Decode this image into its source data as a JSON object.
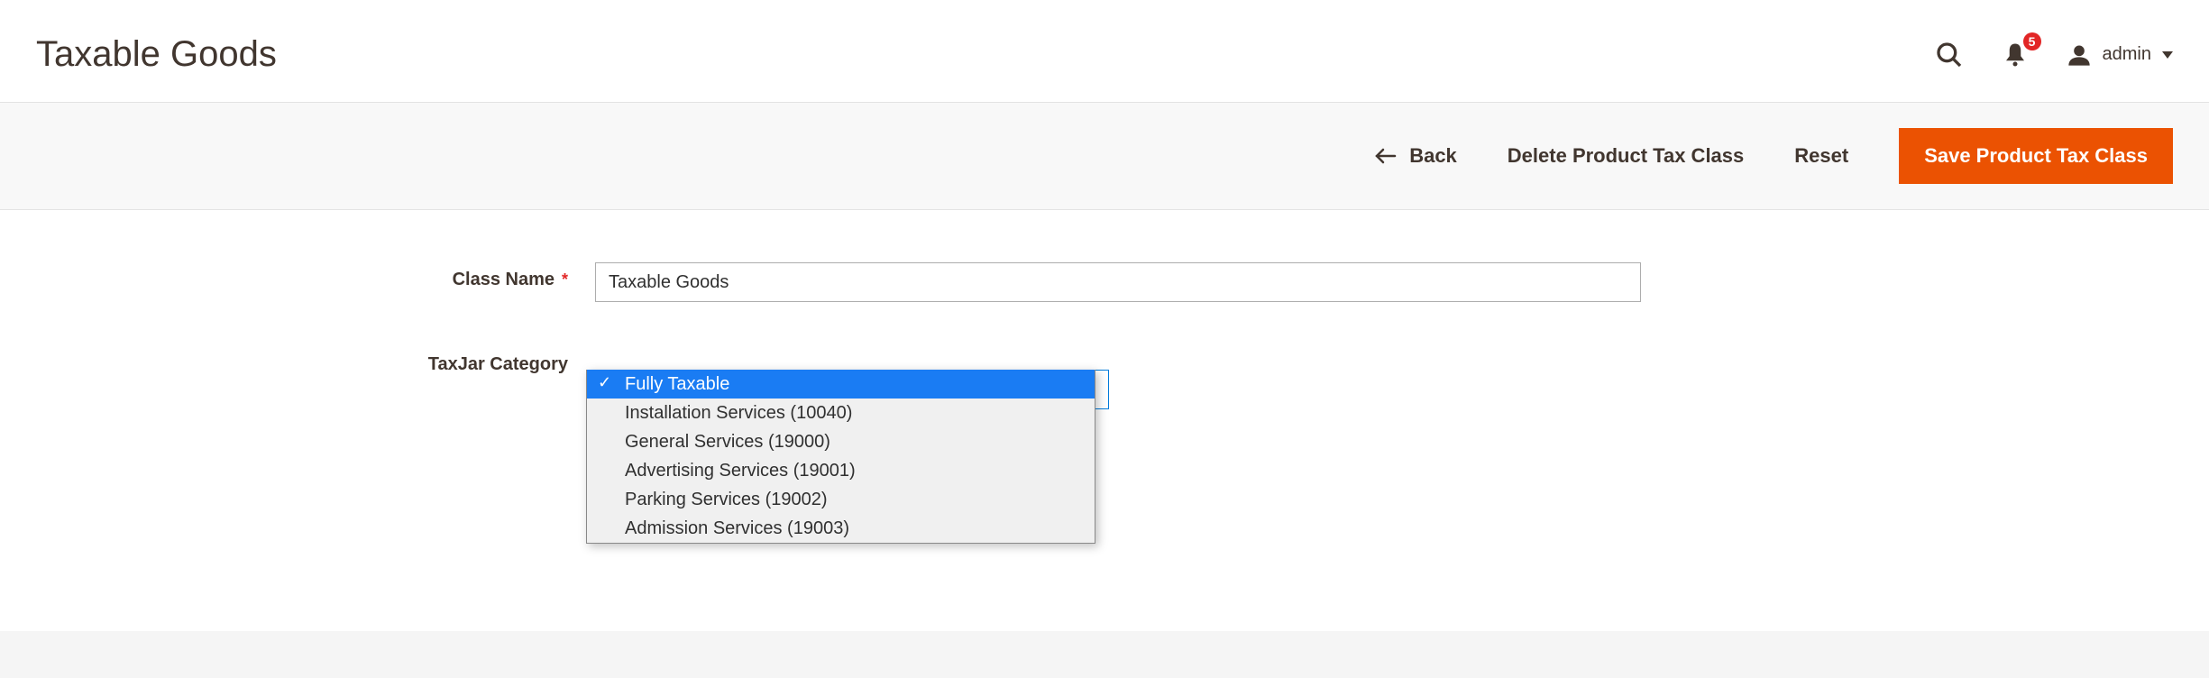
{
  "header": {
    "title": "Taxable Goods",
    "user": "admin",
    "notification_count": "5"
  },
  "actionbar": {
    "back": "Back",
    "delete": "Delete Product Tax Class",
    "reset": "Reset",
    "save": "Save Product Tax Class"
  },
  "form": {
    "class_name_label": "Class Name",
    "class_name_value": "Taxable Goods",
    "taxjar_label": "TaxJar Category",
    "taxjar_options": {
      "o0": "Fully Taxable",
      "o1": "Installation Services (10040)",
      "o2": "General Services (19000)",
      "o3": "Advertising Services (19001)",
      "o4": "Parking Services (19002)",
      "o5": "Admission Services (19003)"
    }
  }
}
